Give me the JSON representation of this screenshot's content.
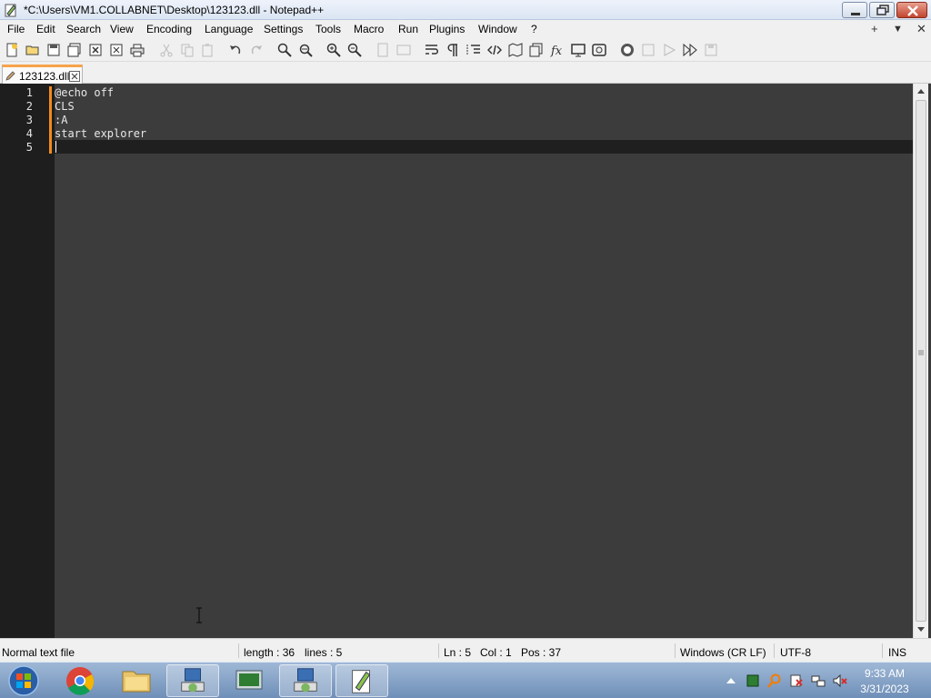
{
  "window": {
    "title": "*C:\\Users\\VM1.COLLABNET\\Desktop\\123123.dll - Notepad++"
  },
  "menu": {
    "items": [
      "File",
      "Edit",
      "Search",
      "View",
      "Encoding",
      "Language",
      "Settings",
      "Tools",
      "Macro",
      "Run",
      "Plugins",
      "Window",
      "?"
    ],
    "right_glyphs": [
      "+",
      "▼",
      "✕"
    ]
  },
  "toolbar": {
    "icons": [
      "new-file-icon",
      "open-file-icon",
      "save-icon",
      "save-all-icon",
      "close-icon",
      "close-all-icon",
      "print-icon",
      "cut-icon",
      "copy-icon",
      "paste-icon",
      "undo-icon",
      "redo-icon",
      "find-icon",
      "replace-icon",
      "zoom-in-icon",
      "zoom-out-icon",
      "sync-vertical-icon",
      "sync-horizontal-icon",
      "word-wrap-icon",
      "show-all-chars-icon",
      "indent-guide-icon",
      "language-xml-icon",
      "document-map-icon",
      "document-list-icon",
      "function-list-icon",
      "folder-workspace-icon",
      "monitoring-icon",
      "record-macro-icon",
      "stop-recording-icon",
      "play-macro-icon",
      "run-macro-multiple-icon",
      "save-macro-icon"
    ]
  },
  "tabs": [
    {
      "label": "123123.dll",
      "modified": true,
      "active": true
    }
  ],
  "editor": {
    "line_numbers": [
      "1",
      "2",
      "3",
      "4",
      "5"
    ],
    "lines": [
      "@echo off",
      "CLS",
      ":A",
      "start explorer",
      ""
    ],
    "current_line": 5,
    "theme": {
      "background": "#3c3c3c",
      "gutter": "#1e1e1e",
      "text": "#e8e8e8",
      "current_line": "#1f1f1f",
      "change_marker": "#f28a1e"
    }
  },
  "status": {
    "file_type": "Normal text file",
    "length": "length : 36",
    "lines": "lines : 5",
    "ln": "Ln : 5",
    "col": "Col : 1",
    "pos": "Pos : 37",
    "eol": "Windows (CR LF)",
    "encoding": "UTF-8",
    "mode": "INS"
  },
  "taskbar": {
    "apps": [
      "start-orb",
      "chrome-icon",
      "file-explorer-icon",
      "network-setup-icon",
      "device-manager-icon",
      "network-setup-icon-2",
      "notepadpp-icon"
    ],
    "tray_icons": [
      "show-hidden-icons-arrow",
      "green-square-icon",
      "magnifier-icon",
      "action-center-icon",
      "network-icon",
      "volume-muted-icon"
    ],
    "time": "9:33 AM",
    "date": "3/31/2023"
  }
}
